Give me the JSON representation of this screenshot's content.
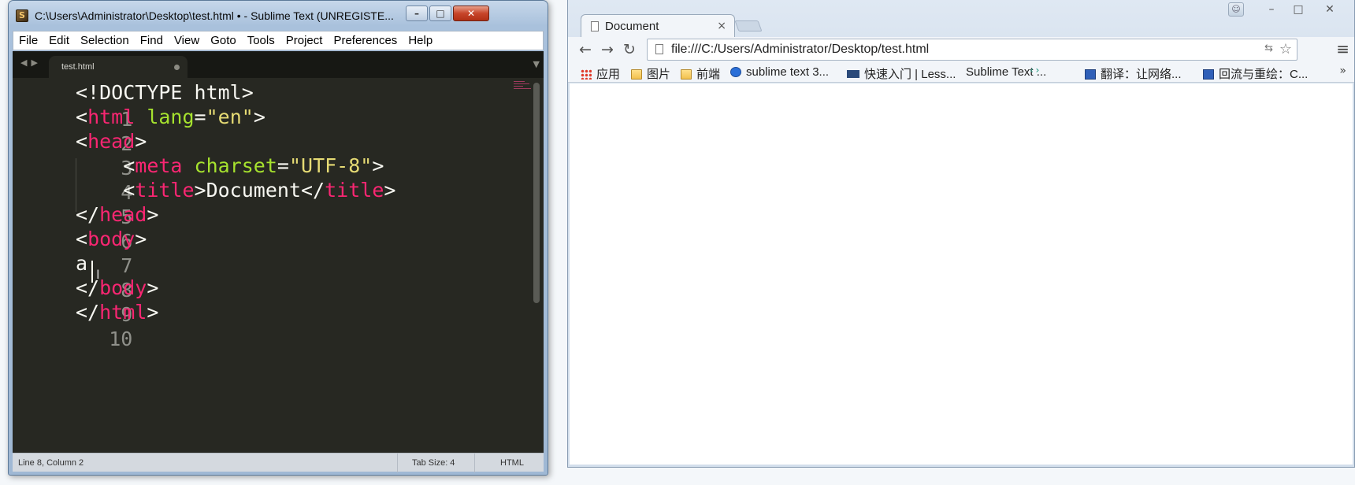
{
  "sublime": {
    "title": "C:\\Users\\Administrator\\Desktop\\test.html • - Sublime Text (UNREGISTE...",
    "menu": [
      "File",
      "Edit",
      "Selection",
      "Find",
      "View",
      "Goto",
      "Tools",
      "Project",
      "Preferences",
      "Help"
    ],
    "tab": {
      "label": "test.html"
    },
    "status": {
      "position": "Line 8, Column 2",
      "tab_size": "Tab Size: 4",
      "syntax": "HTML"
    },
    "line_numbers": [
      "1",
      "2",
      "3",
      "4",
      "5",
      "6",
      "7",
      "8",
      "9",
      "10"
    ],
    "code": {
      "l1": "<!DOCTYPE html>",
      "l2": {
        "open": "<",
        "tag": "html",
        "attr": " lang",
        "eq": "=",
        "str": "\"en\"",
        "close": ">"
      },
      "l3": {
        "open": "<",
        "tag": "head",
        "close": ">"
      },
      "l4": {
        "open": "    <",
        "tag": "meta",
        "attr": " charset",
        "eq": "=",
        "str": "\"UTF-8\"",
        "close": ">"
      },
      "l5": {
        "open": "    <",
        "tag": "title",
        "mid": ">Document</",
        "tag2": "title",
        "close": ">"
      },
      "l6": {
        "open": "</",
        "tag": "head",
        "close": ">"
      },
      "l7": {
        "open": "<",
        "tag": "body",
        "close": ">"
      },
      "l8": "a",
      "l9": {
        "open": "</",
        "tag": "body",
        "close": ">"
      },
      "l10": {
        "open": "</",
        "tag": "html",
        "close": ">"
      }
    },
    "colors": {
      "background": "#272822",
      "tag": "#f92672",
      "attr": "#a6e22e",
      "string": "#e6db74"
    }
  },
  "chrome": {
    "tab_title": "Document",
    "tab_close": "×",
    "url": "file:///C:/Users/Administrator/Desktop/test.html",
    "bookmarks": [
      "应用",
      "图片",
      "前端",
      "sublime text 3...",
      "快速入门 | Less...",
      "Sublime Text ...",
      "翻译：让网络...",
      "回流与重绘：C..."
    ],
    "bookmarks_more": "»"
  }
}
